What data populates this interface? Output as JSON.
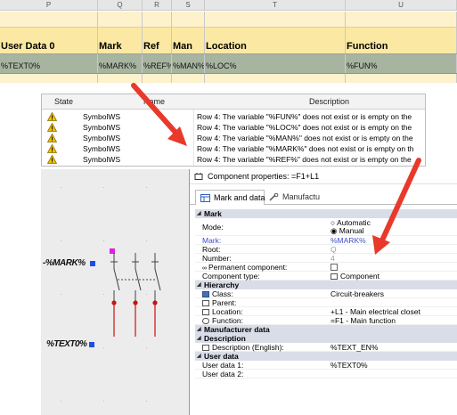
{
  "spreadsheet": {
    "columns": [
      "P",
      "Q",
      "R",
      "S",
      "T",
      "U"
    ],
    "headers": [
      "User Data 0",
      "Mark",
      "Ref",
      "Man",
      "Location",
      "Function"
    ],
    "values": [
      "%TEXT0%",
      "%MARK%",
      "%REF%",
      "%MAN%",
      "%LOC%",
      "%FUN%"
    ]
  },
  "messages": {
    "headers": {
      "state": "State",
      "name": "Name",
      "description": "Description"
    },
    "rows": [
      {
        "name": "SymbolWS",
        "description": "Row 4: The variable \"%FUN%\" does not exist or is empty on the"
      },
      {
        "name": "SymbolWS",
        "description": "Row 4: The variable \"%LOC%\" does not exist or is empty on the"
      },
      {
        "name": "SymbolWS",
        "description": "Row 4: The variable \"%MAN%\" does not exist or is empty on the"
      },
      {
        "name": "SymbolWS",
        "description": "Row 4: The variable \"%MARK%\" does not exist or is empty on th"
      },
      {
        "name": "SymbolWS",
        "description": "Row 4: The variable \"%REF%\" does not exist or is empty on the"
      }
    ]
  },
  "schematic": {
    "mark_label": "-%MARK%",
    "text0_label": "%TEXT0%",
    "colors": {
      "blue_handle": "#1f4fe0",
      "magenta_handle": "#e020e0",
      "red_contact": "#cc1111"
    }
  },
  "properties": {
    "title": "Component properties: =F1+L1",
    "tabs": [
      "Mark and data",
      "Manufactu"
    ],
    "sections": {
      "mark": "Mark",
      "hierarchy": "Hierarchy",
      "manufacturer": "Manufacturer data",
      "description": "Description",
      "user_data": "User data"
    },
    "rows": {
      "mode_label": "Mode:",
      "mode_auto": "Automatic",
      "mode_manual": "Manual",
      "mark_label": "Mark:",
      "mark_value": "%MARK%",
      "root_label": "Root:",
      "root_value": "Q",
      "number_label": "Number:",
      "number_value": "4",
      "permanent_label": "Permanent component:",
      "type_label": "Component type:",
      "type_value": "Component",
      "class_label": "Class:",
      "class_value": "Circuit-breakers",
      "parent_label": "Parent:",
      "location_label": "Location:",
      "location_value": "+L1 - Main electrical closet",
      "function_label": "Function:",
      "function_value": "=F1 - Main function",
      "desc_label": "Description (English):",
      "desc_value": "%TEXT_EN%",
      "ud1_label": "User data 1:",
      "ud1_value": "%TEXT0%",
      "ud2_label": "User data 2:"
    }
  },
  "colors": {
    "arrow": "#e8392b",
    "sheet_title_bg": "#fbe9a3",
    "sheet_value_bg": "#a7b5a0"
  }
}
